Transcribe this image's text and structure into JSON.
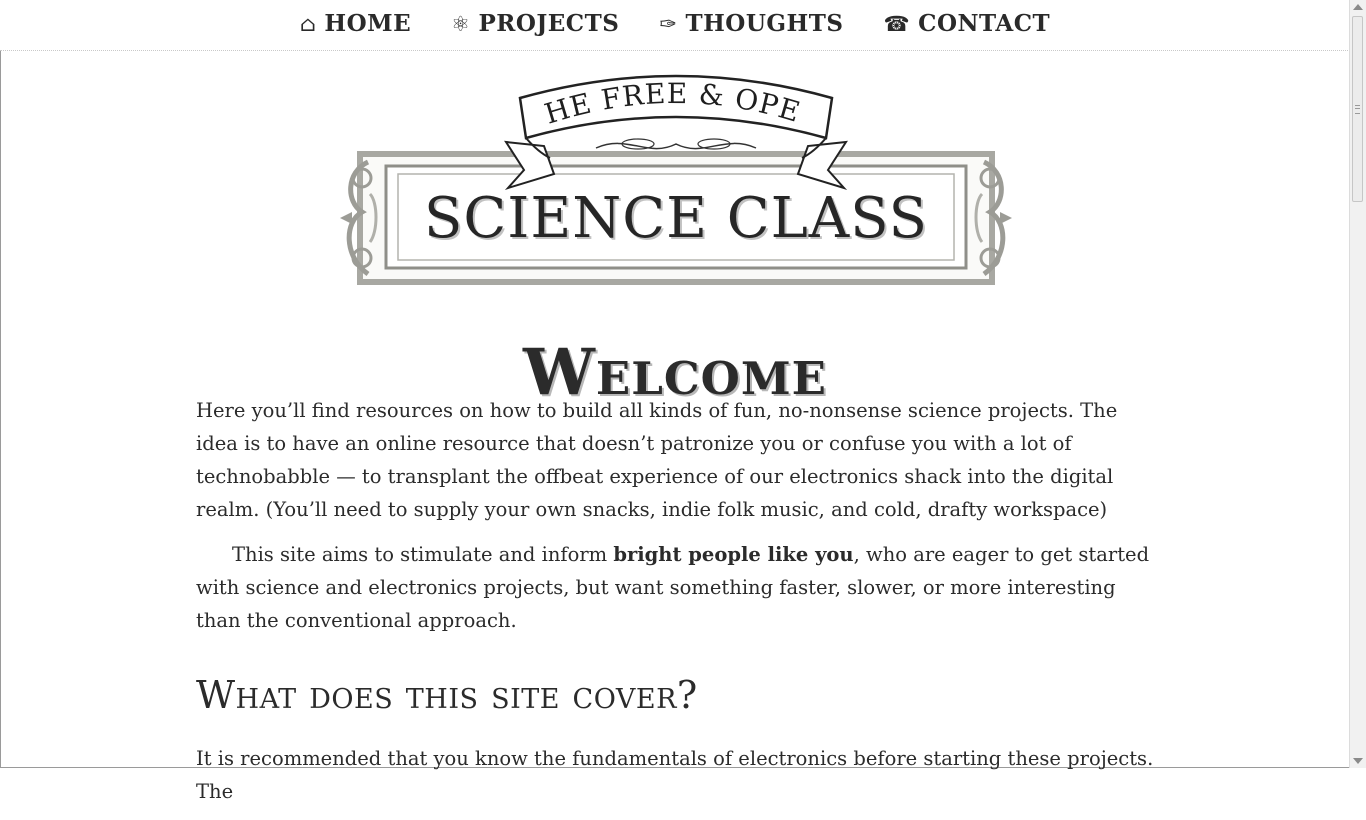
{
  "nav": {
    "items": [
      {
        "icon": "⌂",
        "icon_name": "home-icon",
        "label": "HOME"
      },
      {
        "icon": "⚛",
        "icon_name": "atom-icon",
        "label": "PROJECTS"
      },
      {
        "icon": "✑",
        "icon_name": "pen-icon",
        "label": "THOUGHTS"
      },
      {
        "icon": "☎",
        "icon_name": "telephone-icon",
        "label": "CONTACT"
      }
    ]
  },
  "logo": {
    "banner_text": "THE FREE & OPEN",
    "main_text": "SCIENCE CLASS"
  },
  "page": {
    "title": "Welcome",
    "intro_paragraph": "Here you’ll find resources on how to build all kinds of fun, no-nonsense science projects. The idea is to have an online resource that doesn’t patronize you or confuse you with a lot of technobabble — to transplant the offbeat experience of our electronics shack into the digital realm. (You’ll need to supply your own snacks, indie folk music, and cold, drafty workspace)",
    "aims_before": "This site aims to stimulate and inform ",
    "aims_bold": "bright people like you",
    "aims_after": ", who are eager to get started with science and electronics projects, but want something faster, slower, or more interesting than the conventional approach.",
    "section_heading": "What does this site cover?",
    "section_paragraph": "It is recommended that you know the fundamentals of electronics before starting these projects. The"
  },
  "colors": {
    "text": "#2b2b2b",
    "frame": "#9c9c96",
    "background": "#ffffff"
  }
}
